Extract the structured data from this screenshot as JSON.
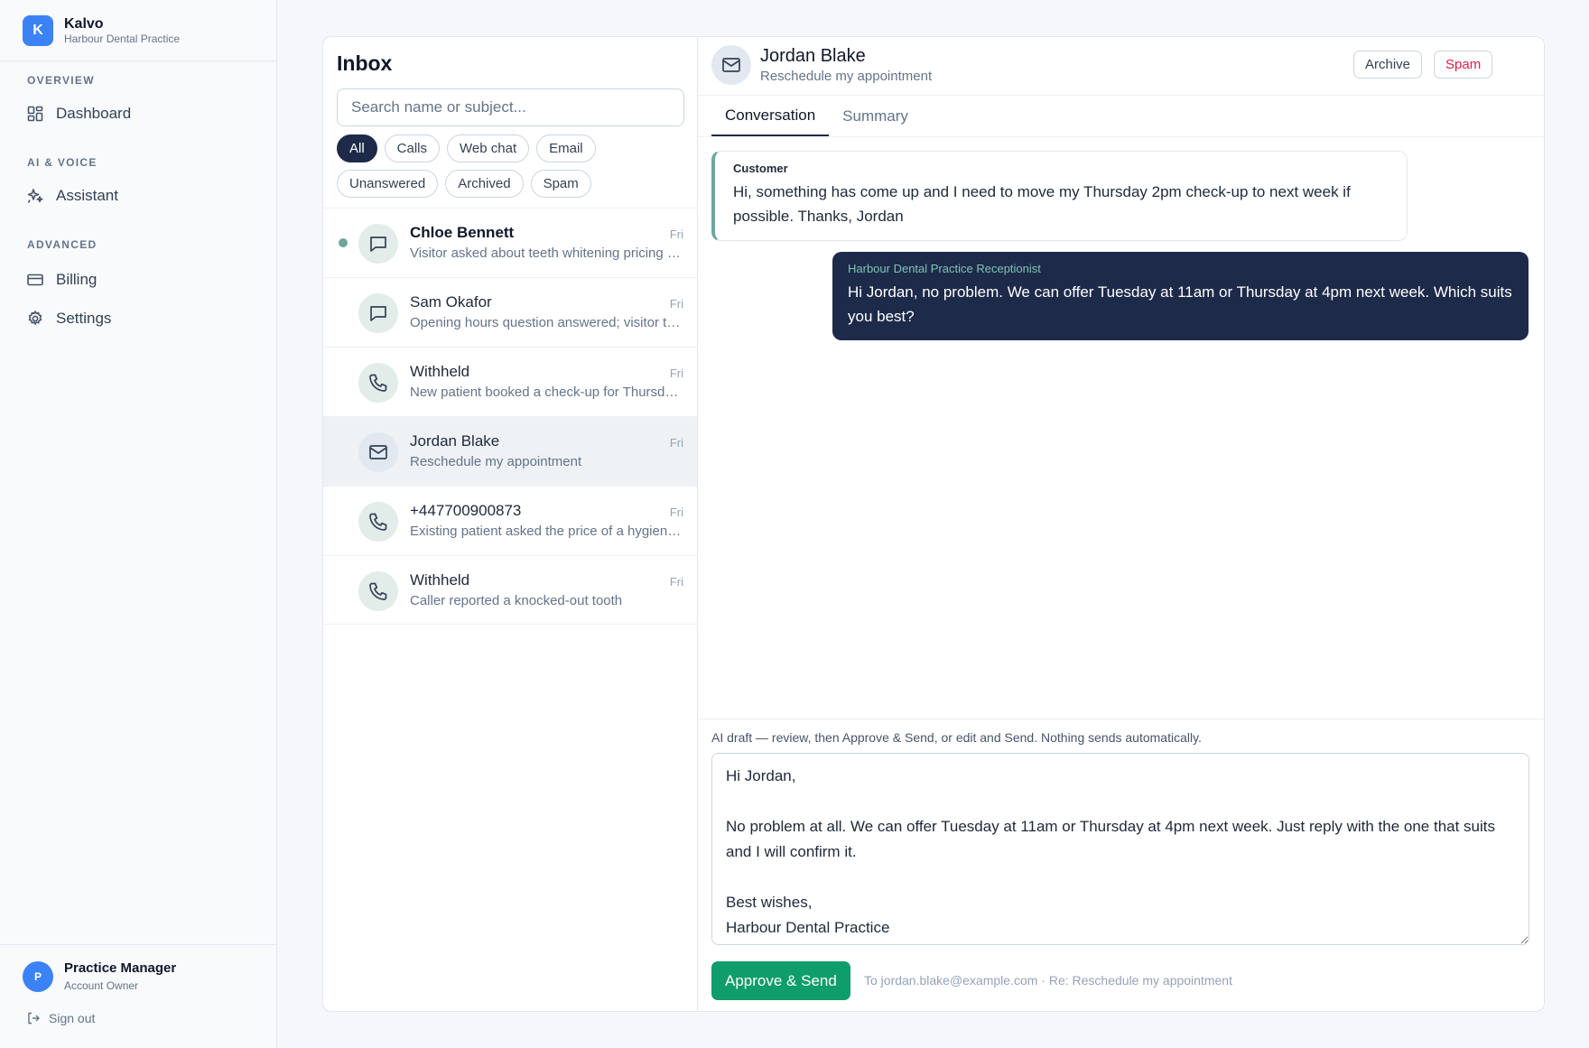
{
  "brand": {
    "logo_letter": "K",
    "name": "Kalvo",
    "subtitle": "Harbour Dental Practice"
  },
  "nav": {
    "sections": [
      "OVERVIEW",
      "AI & VOICE",
      "ADVANCED"
    ],
    "items": [
      {
        "label": "Dashboard",
        "icon": "dashboard-icon"
      },
      {
        "label": "Assistant",
        "icon": "sparkle-icon"
      },
      {
        "label": "Billing",
        "icon": "card-icon"
      },
      {
        "label": "Settings",
        "icon": "gear-icon"
      }
    ]
  },
  "user": {
    "initial": "P",
    "name": "Practice Manager",
    "role": "Account Owner",
    "signout": "Sign out"
  },
  "inbox": {
    "title": "Inbox",
    "search_placeholder": "Search name or subject...",
    "filters": [
      "All",
      "Calls",
      "Web chat",
      "Email",
      "Unanswered",
      "Archived",
      "Spam"
    ],
    "active_filter": "All",
    "conversations": [
      {
        "name": "Chloe Bennett",
        "time": "Fri",
        "snippet": "Visitor asked about teeth whitening pricing and availability",
        "channel": "chat",
        "unread": true
      },
      {
        "name": "Sam Okafor",
        "time": "Fri",
        "snippet": "Opening hours question answered; visitor thanked the team",
        "channel": "chat",
        "unread": false
      },
      {
        "name": "Withheld",
        "time": "Fri",
        "snippet": "New patient booked a check-up for Thursday morning",
        "channel": "call",
        "unread": false
      },
      {
        "name": "Jordan Blake",
        "time": "Fri",
        "snippet": "Reschedule my appointment",
        "channel": "email",
        "unread": false,
        "selected": true
      },
      {
        "name": "+447700900873",
        "time": "Fri",
        "snippet": "Existing patient asked the price of a hygiene appointment",
        "channel": "call",
        "unread": false
      },
      {
        "name": "Withheld",
        "time": "Fri",
        "snippet": "Caller reported a knocked-out tooth",
        "channel": "call",
        "unread": false
      }
    ]
  },
  "detail": {
    "name": "Jordan Blake",
    "subject": "Reschedule my appointment",
    "archive_label": "Archive",
    "spam_label": "Spam",
    "tabs": [
      "Conversation",
      "Summary"
    ],
    "messages": [
      {
        "role": "Customer",
        "text": "Hi, something has come up and I need to move my Thursday 2pm check-up to next week if possible. Thanks, Jordan"
      },
      {
        "role": "Harbour Dental Practice Receptionist",
        "text": "Hi Jordan, no problem. We can offer Tuesday at 11am or Thursday at 4pm next week. Which suits you best?"
      }
    ],
    "draft_note": "AI draft — review, then Approve & Send, or edit and Send. Nothing sends automatically.",
    "draft_text": "Hi Jordan,\n\nNo problem at all. We can offer Tuesday at 11am or Thursday at 4pm next week. Just reply with the one that suits and I will confirm it.\n\nBest wishes,\nHarbour Dental Practice",
    "approve_label": "Approve & Send",
    "send_meta": "To jordan.blake@example.com · Re: Reschedule my appointment"
  },
  "colors": {
    "accent": "#1e2a4a",
    "brand": "#3b82f6",
    "success": "#0f9d6b",
    "danger": "#e11d48",
    "teal": "#6ba89b"
  }
}
